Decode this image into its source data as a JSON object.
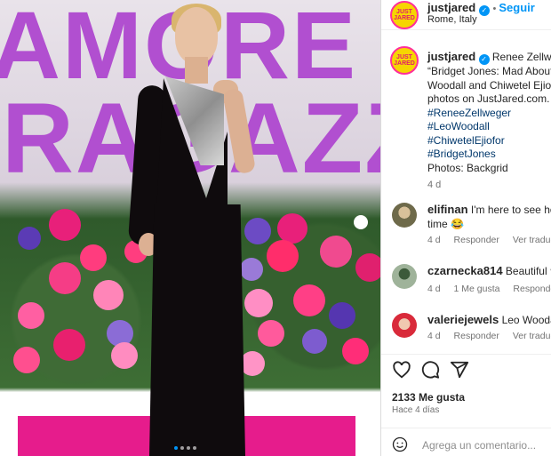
{
  "post": {
    "account": "justjared",
    "avatar_label": "JUST JARED",
    "follow_label": "Seguir",
    "location": "Rome, Italy",
    "backdrop_text": [
      "AMORE",
      "RAGAZZO"
    ],
    "caption_lines": [
      "Renee Zellwege",
      "“Bridget Jones: Mad About",
      "Woodall and Chiwetel Ejiofo",
      "photos on JustJared.com."
    ],
    "hashtags": [
      "#ReneeZellweger",
      "#LeoWoodall",
      "#ChiwetelEjiofor",
      "#BridgetJones"
    ],
    "credit": "Photos: Backgrid",
    "caption_age": "4 d",
    "likes": "2133 Me gusta",
    "time_ago": "Hace 4 días",
    "add_comment_placeholder": "Agrega un comentario...",
    "carousel": {
      "count": 4,
      "active": 1
    }
  },
  "comments": [
    {
      "user": "elifinan",
      "text_line1": "I'm here to see how",
      "text_line2": "time 😂",
      "age": "4 d",
      "reply": "Responder",
      "translate": "Ver traducción",
      "likes_label": ""
    },
    {
      "user": "czarnecka814",
      "text_line1": "Beautiful ❤",
      "text_line2": "",
      "age": "4 d",
      "reply": "Responder",
      "translate": "",
      "likes_label": "1 Me gusta"
    },
    {
      "user": "valeriejewels",
      "text_line1": "Leo Woodall l",
      "text_line2": "",
      "age": "4 d",
      "reply": "Responder",
      "translate": "Ver traducción",
      "likes_label": ""
    }
  ],
  "icons": {
    "like": "heart-icon",
    "comment": "comment-icon",
    "share": "share-icon",
    "emoji": "emoji-icon",
    "verified": "verified-badge-icon"
  },
  "colors": {
    "accent": "#0095f6",
    "brand_yellow": "#f6d500",
    "brand_pink": "#e21b6b",
    "backdrop_purple": "#b14fd0"
  }
}
